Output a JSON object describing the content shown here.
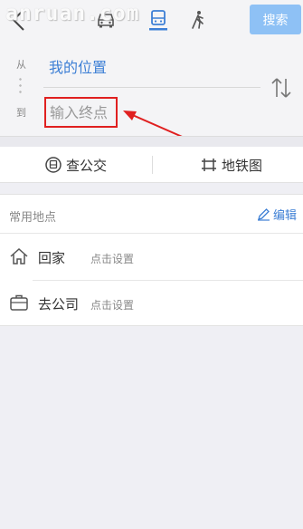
{
  "watermark": "anruan.com",
  "header": {
    "search_label": "搜索",
    "modes": [
      "car-icon",
      "bus-icon",
      "walk-icon"
    ],
    "active_mode": "bus"
  },
  "route": {
    "from_label": "从",
    "to_label": "到",
    "from_value": "我的位置",
    "to_placeholder": "输入终点"
  },
  "actions": {
    "bus_label": "查公交",
    "subway_label": "地铁图"
  },
  "favorites": {
    "title": "常用地点",
    "edit_label": "编辑",
    "items": [
      {
        "name": "回家",
        "hint": "点击设置",
        "icon": "home-icon"
      },
      {
        "name": "去公司",
        "hint": "点击设置",
        "icon": "briefcase-icon"
      }
    ]
  },
  "colors": {
    "accent": "#3d7fd5",
    "search_button": "#8ec1f5",
    "highlight": "#e02020"
  }
}
